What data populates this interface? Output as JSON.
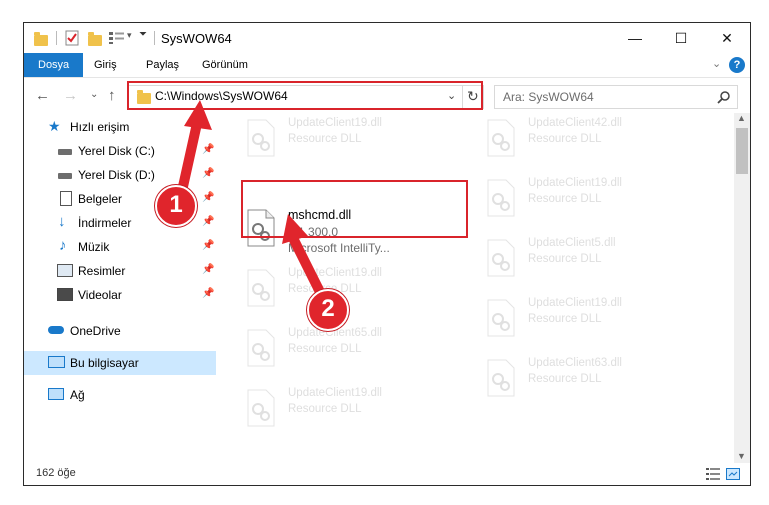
{
  "window": {
    "title": "SysWOW64",
    "minimize": "—",
    "maximize": "☐",
    "close": "✕"
  },
  "ribbon": {
    "tabs": [
      "Dosya",
      "Giriş",
      "Paylaş",
      "Görünüm"
    ],
    "help": "?"
  },
  "address": {
    "path": "C:\\Windows\\SysWOW64",
    "search_placeholder": "Ara: SysWOW64"
  },
  "sidebar": {
    "items": [
      {
        "label": "Hızlı erişim",
        "icon": "star-icon"
      },
      {
        "label": "Yerel Disk (C:)",
        "icon": "drive-icon"
      },
      {
        "label": "Yerel Disk (D:)",
        "icon": "drive-icon"
      },
      {
        "label": "Belgeler",
        "icon": "document-icon"
      },
      {
        "label": "İndirmeler",
        "icon": "download-icon"
      },
      {
        "label": "Müzik",
        "icon": "music-icon"
      },
      {
        "label": "Resimler",
        "icon": "pictures-icon"
      },
      {
        "label": "Videolar",
        "icon": "video-icon"
      },
      {
        "label": "OneDrive",
        "icon": "cloud-icon"
      },
      {
        "label": "Bu bilgisayar",
        "icon": "computer-icon"
      },
      {
        "label": "Ağ",
        "icon": "network-icon"
      }
    ]
  },
  "files": {
    "left": [
      {
        "name": "UpdateClient19.dll",
        "desc": "Resource DLL"
      },
      {
        "name": "mshcmd.dll",
        "version": "2.1.300.0",
        "desc": "Microsoft IntelliTy..."
      },
      {
        "name": "UpdateClient19.dll",
        "desc": "Resource DLL"
      },
      {
        "name": "UpdateClient65.dll",
        "desc": "Resource DLL"
      },
      {
        "name": "UpdateClient19.dll",
        "desc": "Resource DLL"
      }
    ],
    "right": [
      {
        "name": "UpdateClient42.dll",
        "desc": "Resource DLL"
      },
      {
        "name": "UpdateClient19.dll",
        "desc": "Resource DLL"
      },
      {
        "name": "UpdateClient5.dll",
        "desc": "Resource DLL"
      },
      {
        "name": "UpdateClient19.dll",
        "desc": "Resource DLL"
      },
      {
        "name": "UpdateClient63.dll",
        "desc": "Resource DLL"
      }
    ]
  },
  "status": {
    "count": "162 öğe"
  },
  "annotations": {
    "marker1": "1",
    "marker2": "2"
  },
  "colors": {
    "accent": "#1979ca",
    "highlight": "#d9242b",
    "selection": "#cce8ff"
  }
}
